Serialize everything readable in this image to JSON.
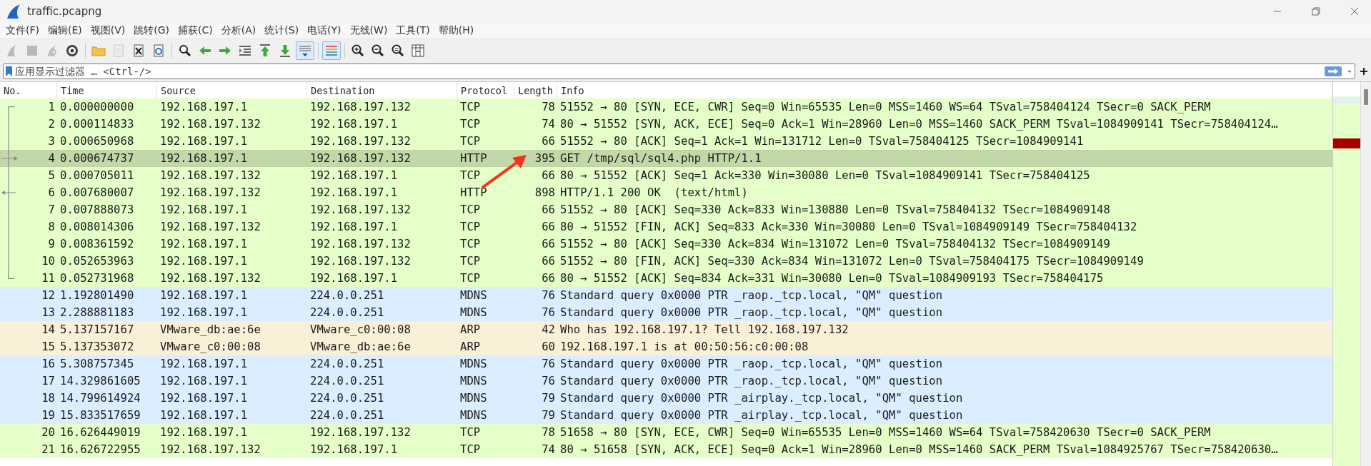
{
  "window": {
    "title": "traffic.pcapng"
  },
  "menu": [
    "文件(F)",
    "编辑(E)",
    "视图(V)",
    "跳转(G)",
    "捕获(C)",
    "分析(A)",
    "统计(S)",
    "电话(Y)",
    "无线(W)",
    "工具(T)",
    "帮助(H)"
  ],
  "toolbar": [
    {
      "kind": "start",
      "disabled": true,
      "pressed": false
    },
    {
      "kind": "stop",
      "disabled": true,
      "pressed": false
    },
    {
      "kind": "restart",
      "disabled": true,
      "pressed": false
    },
    {
      "kind": "options",
      "disabled": false,
      "pressed": false
    },
    {
      "kind": "sep"
    },
    {
      "kind": "open",
      "disabled": false,
      "pressed": false
    },
    {
      "kind": "save",
      "disabled": true,
      "pressed": false
    },
    {
      "kind": "close",
      "disabled": false,
      "pressed": false
    },
    {
      "kind": "reload",
      "disabled": false,
      "pressed": false
    },
    {
      "kind": "sep"
    },
    {
      "kind": "find",
      "disabled": false,
      "pressed": false
    },
    {
      "kind": "back",
      "disabled": false,
      "pressed": false
    },
    {
      "kind": "forward",
      "disabled": false,
      "pressed": false
    },
    {
      "kind": "goto",
      "disabled": false,
      "pressed": false
    },
    {
      "kind": "first",
      "disabled": false,
      "pressed": false
    },
    {
      "kind": "last",
      "disabled": false,
      "pressed": false
    },
    {
      "kind": "autoscroll",
      "disabled": false,
      "pressed": true
    },
    {
      "kind": "sep"
    },
    {
      "kind": "colorize",
      "disabled": false,
      "pressed": true
    },
    {
      "kind": "sep"
    },
    {
      "kind": "zoom-in",
      "disabled": false,
      "pressed": false
    },
    {
      "kind": "zoom-out",
      "disabled": false,
      "pressed": false
    },
    {
      "kind": "zoom-reset",
      "disabled": false,
      "pressed": false
    },
    {
      "kind": "resize",
      "disabled": false,
      "pressed": false
    }
  ],
  "filter": {
    "placeholder": "应用显示过滤器 … <Ctrl-/>"
  },
  "table": {
    "columns": [
      "No.",
      "Time",
      "Source",
      "Destination",
      "Protocol",
      "Length",
      "Info"
    ],
    "rows": [
      {
        "no": "1",
        "time": "0.000000000",
        "source": "192.168.197.1",
        "destination": "192.168.197.132",
        "protocol": "TCP",
        "length": "78",
        "info": "51552 → 80 [SYN, ECE, CWR] Seq=0 Win=65535 Len=0 MSS=1460 WS=64 TSval=758404124 TSecr=0 SACK_PERM",
        "color": "#e4ffc7",
        "selected": false,
        "kind": "first"
      },
      {
        "no": "2",
        "time": "0.000114833",
        "source": "192.168.197.132",
        "destination": "192.168.197.1",
        "protocol": "TCP",
        "length": "74",
        "info": "80 → 51552 [SYN, ACK, ECE] Seq=0 Ack=1 Win=28960 Len=0 MSS=1460 SACK_PERM TSval=1084909141 TSecr=758404124…",
        "color": "#e4ffc7",
        "selected": false,
        "kind": "mid"
      },
      {
        "no": "3",
        "time": "0.000650968",
        "source": "192.168.197.1",
        "destination": "192.168.197.132",
        "protocol": "TCP",
        "length": "66",
        "info": "51552 → 80 [ACK] Seq=1 Ack=1 Win=131712 Len=0 TSval=758404125 TSecr=1084909141",
        "color": "#e4ffc7",
        "selected": false,
        "kind": "mid"
      },
      {
        "no": "4",
        "time": "0.000674737",
        "source": "192.168.197.1",
        "destination": "192.168.197.132",
        "protocol": "HTTP",
        "length": "395",
        "info": "GET /tmp/sql/sql4.php HTTP/1.1",
        "color": "#c3d8a9",
        "selected": true,
        "kind": "request"
      },
      {
        "no": "5",
        "time": "0.000705011",
        "source": "192.168.197.132",
        "destination": "192.168.197.1",
        "protocol": "TCP",
        "length": "66",
        "info": "80 → 51552 [ACK] Seq=1 Ack=330 Win=30080 Len=0 TSval=1084909141 TSecr=758404125",
        "color": "#e4ffc7",
        "selected": false,
        "kind": "mid"
      },
      {
        "no": "6",
        "time": "0.007680007",
        "source": "192.168.197.132",
        "destination": "192.168.197.1",
        "protocol": "HTTP",
        "length": "898",
        "info": "HTTP/1.1 200 OK  (text/html)",
        "color": "#e4ffc7",
        "selected": false,
        "kind": "response"
      },
      {
        "no": "7",
        "time": "0.007888073",
        "source": "192.168.197.1",
        "destination": "192.168.197.132",
        "protocol": "TCP",
        "length": "66",
        "info": "51552 → 80 [ACK] Seq=330 Ack=833 Win=130880 Len=0 TSval=758404132 TSecr=1084909148",
        "color": "#e4ffc7",
        "selected": false,
        "kind": "mid"
      },
      {
        "no": "8",
        "time": "0.008014306",
        "source": "192.168.197.132",
        "destination": "192.168.197.1",
        "protocol": "TCP",
        "length": "66",
        "info": "80 → 51552 [FIN, ACK] Seq=833 Ack=330 Win=30080 Len=0 TSval=1084909149 TSecr=758404132",
        "color": "#e4ffc7",
        "selected": false,
        "kind": "mid"
      },
      {
        "no": "9",
        "time": "0.008361592",
        "source": "192.168.197.1",
        "destination": "192.168.197.132",
        "protocol": "TCP",
        "length": "66",
        "info": "51552 → 80 [ACK] Seq=330 Ack=834 Win=131072 Len=0 TSval=758404132 TSecr=1084909149",
        "color": "#e4ffc7",
        "selected": false,
        "kind": "mid"
      },
      {
        "no": "10",
        "time": "0.052653963",
        "source": "192.168.197.1",
        "destination": "192.168.197.132",
        "protocol": "TCP",
        "length": "66",
        "info": "51552 → 80 [FIN, ACK] Seq=330 Ack=834 Win=131072 Len=0 TSval=758404175 TSecr=1084909149",
        "color": "#e4ffc7",
        "selected": false,
        "kind": "mid"
      },
      {
        "no": "11",
        "time": "0.052731968",
        "source": "192.168.197.132",
        "destination": "192.168.197.1",
        "protocol": "TCP",
        "length": "66",
        "info": "80 → 51552 [ACK] Seq=834 Ack=331 Win=30080 Len=0 TSval=1084909193 TSecr=758404175",
        "color": "#e4ffc7",
        "selected": false,
        "kind": "last"
      },
      {
        "no": "12",
        "time": "1.192801490",
        "source": "192.168.197.1",
        "destination": "224.0.0.251",
        "protocol": "MDNS",
        "length": "76",
        "info": "Standard query 0x0000 PTR _raop._tcp.local, \"QM\" question",
        "color": "#daeeff",
        "selected": false
      },
      {
        "no": "13",
        "time": "2.288881183",
        "source": "192.168.197.1",
        "destination": "224.0.0.251",
        "protocol": "MDNS",
        "length": "76",
        "info": "Standard query 0x0000 PTR _raop._tcp.local, \"QM\" question",
        "color": "#daeeff",
        "selected": false
      },
      {
        "no": "14",
        "time": "5.137157167",
        "source": "VMware_db:ae:6e",
        "destination": "VMware_c0:00:08",
        "protocol": "ARP",
        "length": "42",
        "info": "Who has 192.168.197.1? Tell 192.168.197.132",
        "color": "#faf0d7",
        "selected": false
      },
      {
        "no": "15",
        "time": "5.137353072",
        "source": "VMware_c0:00:08",
        "destination": "VMware_db:ae:6e",
        "protocol": "ARP",
        "length": "60",
        "info": "192.168.197.1 is at 00:50:56:c0:00:08",
        "color": "#faf0d7",
        "selected": false
      },
      {
        "no": "16",
        "time": "5.308757345",
        "source": "192.168.197.1",
        "destination": "224.0.0.251",
        "protocol": "MDNS",
        "length": "76",
        "info": "Standard query 0x0000 PTR _raop._tcp.local, \"QM\" question",
        "color": "#daeeff",
        "selected": false
      },
      {
        "no": "17",
        "time": "14.329861605",
        "source": "192.168.197.1",
        "destination": "224.0.0.251",
        "protocol": "MDNS",
        "length": "76",
        "info": "Standard query 0x0000 PTR _raop._tcp.local, \"QM\" question",
        "color": "#daeeff",
        "selected": false
      },
      {
        "no": "18",
        "time": "14.799614924",
        "source": "192.168.197.1",
        "destination": "224.0.0.251",
        "protocol": "MDNS",
        "length": "79",
        "info": "Standard query 0x0000 PTR _airplay._tcp.local, \"QM\" question",
        "color": "#daeeff",
        "selected": false
      },
      {
        "no": "19",
        "time": "15.833517659",
        "source": "192.168.197.1",
        "destination": "224.0.0.251",
        "protocol": "MDNS",
        "length": "79",
        "info": "Standard query 0x0000 PTR _airplay._tcp.local, \"QM\" question",
        "color": "#daeeff",
        "selected": false
      },
      {
        "no": "20",
        "time": "16.626449019",
        "source": "192.168.197.1",
        "destination": "192.168.197.132",
        "protocol": "TCP",
        "length": "78",
        "info": "51658 → 80 [SYN, ECE, CWR] Seq=0 Win=65535 Len=0 MSS=1460 WS=64 TSval=758420630 TSecr=0 SACK_PERM",
        "color": "#e4ffc7",
        "selected": false
      },
      {
        "no": "21",
        "time": "16.626722955",
        "source": "192.168.197.132",
        "destination": "192.168.197.1",
        "protocol": "TCP",
        "length": "74",
        "info": "80 → 51658 [SYN, ACK, ECE] Seq=0 Ack=1 Win=28960 Len=0 MSS=1460 SACK_PERM TSval=1084925767 TSecr=758420630…",
        "color": "#e4ffc7",
        "selected": false
      }
    ]
  }
}
